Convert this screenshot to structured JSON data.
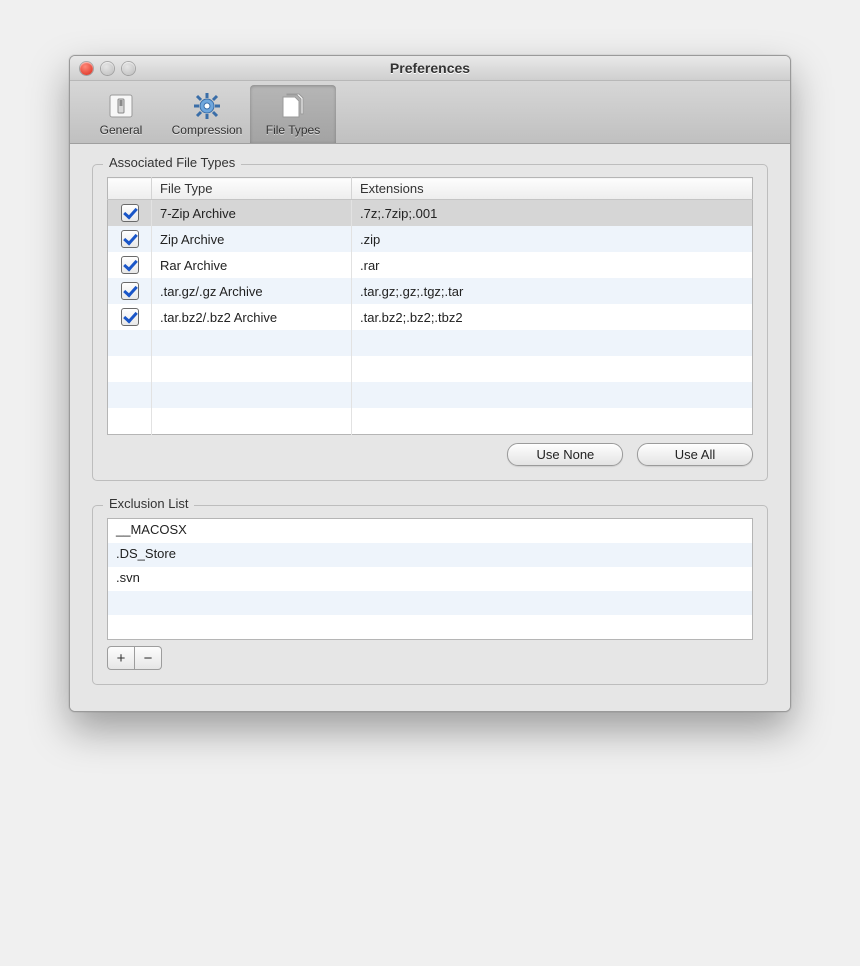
{
  "window": {
    "title": "Preferences"
  },
  "toolbar": {
    "items": [
      {
        "label": "General"
      },
      {
        "label": "Compression"
      },
      {
        "label": "File Types"
      }
    ],
    "selected_index": 2
  },
  "associated": {
    "legend": "Associated File Types",
    "headers": {
      "check": "",
      "type": "File Type",
      "ext": "Extensions"
    },
    "rows": [
      {
        "checked": true,
        "type": "7-Zip Archive",
        "ext": ".7z;.7zip;.001"
      },
      {
        "checked": true,
        "type": "Zip Archive",
        "ext": ".zip"
      },
      {
        "checked": true,
        "type": "Rar Archive",
        "ext": ".rar"
      },
      {
        "checked": true,
        "type": ".tar.gz/.gz Archive",
        "ext": ".tar.gz;.gz;.tgz;.tar"
      },
      {
        "checked": true,
        "type": ".tar.bz2/.bz2 Archive",
        "ext": ".tar.bz2;.bz2;.tbz2"
      }
    ],
    "blank_rows": 4,
    "buttons": {
      "use_none": "Use None",
      "use_all": "Use All"
    }
  },
  "exclusion": {
    "legend": "Exclusion List",
    "items": [
      "__MACOSX",
      ".DS_Store",
      ".svn"
    ],
    "blank_rows": 2,
    "add_label": "+",
    "remove_label": "−"
  }
}
